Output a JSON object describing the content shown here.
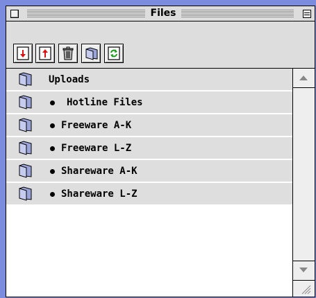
{
  "window": {
    "title": "Files"
  },
  "toolbar": {
    "buttons": [
      {
        "name": "download-button",
        "icon": "download-arrow-icon"
      },
      {
        "name": "upload-button",
        "icon": "upload-arrow-icon"
      },
      {
        "name": "delete-button",
        "icon": "trash-icon"
      },
      {
        "name": "new-folder-button",
        "icon": "folder-icon"
      },
      {
        "name": "refresh-button",
        "icon": "refresh-icon"
      }
    ]
  },
  "files": {
    "items": [
      {
        "label": "Uploads",
        "bullet": false
      },
      {
        "label": "Hotline Files",
        "bullet": true
      },
      {
        "label": "Freeware A-K",
        "bullet": true
      },
      {
        "label": "Freeware L-Z",
        "bullet": true
      },
      {
        "label": "Shareware A-K",
        "bullet": true
      },
      {
        "label": "Shareware L-Z",
        "bullet": true
      }
    ]
  },
  "colors": {
    "desktop": "#7b8cde",
    "window": "#dddddd",
    "row": "#dedede",
    "arrow_red": "#e01010",
    "refresh_green": "#18a018"
  }
}
